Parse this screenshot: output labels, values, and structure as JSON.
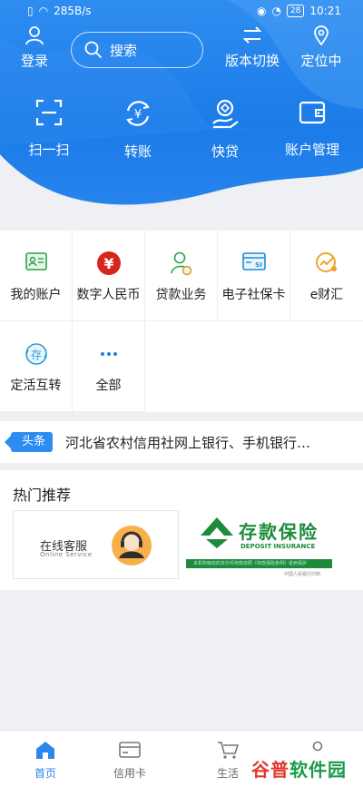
{
  "status_bar": {
    "speed": "285B/s",
    "battery": "28",
    "time": "10:21"
  },
  "header": {
    "login_label": "登录",
    "search_placeholder": "搜索",
    "version_label": "版本切换",
    "locate_label": "定位中"
  },
  "quick_actions": [
    {
      "label": "扫一扫",
      "icon": "scan-icon"
    },
    {
      "label": "转账",
      "icon": "transfer-icon"
    },
    {
      "label": "快贷",
      "icon": "quick-loan-icon"
    },
    {
      "label": "账户管理",
      "icon": "wallet-icon"
    }
  ],
  "services": [
    {
      "label": "我的账户",
      "icon": "account-card-icon"
    },
    {
      "label": "数字人民币",
      "icon": "digital-rmb-icon"
    },
    {
      "label": "贷款业务",
      "icon": "loan-person-icon"
    },
    {
      "label": "电子社保卡",
      "icon": "social-security-card-icon"
    },
    {
      "label": "e财汇",
      "icon": "e-finance-icon"
    },
    {
      "label": "定活互转",
      "icon": "deposit-transfer-icon"
    },
    {
      "label": "全部",
      "icon": "more-dots-icon"
    }
  ],
  "headline": {
    "tag": "头条",
    "text": "河北省农村信用社网上银行、手机银行…"
  },
  "recommend": {
    "title": "热门推荐",
    "online_service_cn": "在线客服",
    "online_service_en": "Online Service",
    "deposit_cn": "存款保险",
    "deposit_en": "DEPOSIT INSURANCE",
    "deposit_bar": "本机构吸收的本外币存款依照《存款保险条例》受到保护",
    "deposit_foot": "中国人民银行印制"
  },
  "bottom_nav": [
    {
      "label": "首页",
      "active": true
    },
    {
      "label": "信用卡",
      "active": false
    },
    {
      "label": "生活",
      "active": false
    }
  ],
  "watermark": {
    "part1": "谷普",
    "part2": "软件园"
  },
  "colors": {
    "primary": "#2b86ee",
    "green": "#1c8b3c",
    "red": "#e0392d"
  }
}
